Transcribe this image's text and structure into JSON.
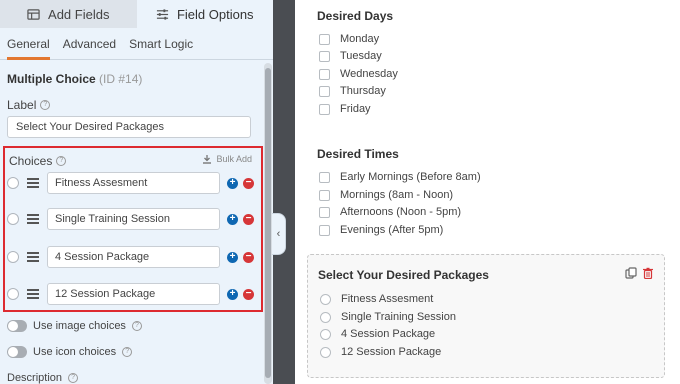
{
  "tabs": {
    "add_fields": "Add Fields",
    "field_options": "Field Options"
  },
  "subtabs": [
    "General",
    "Advanced",
    "Smart Logic"
  ],
  "field": {
    "type": "Multiple Choice",
    "id_label": "(ID #14)"
  },
  "label_section": {
    "label": "Label",
    "value": "Select Your Desired Packages"
  },
  "choices_section": {
    "label": "Choices",
    "bulk_add": "Bulk Add",
    "items": [
      "Fitness Assesment",
      "Single Training Session",
      "4 Session Package",
      "12 Session Package"
    ]
  },
  "toggles": {
    "image_choices": "Use image choices",
    "icon_choices": "Use icon choices"
  },
  "description_label": "Description",
  "preview": {
    "days": {
      "title": "Desired Days",
      "options": [
        "Monday",
        "Tuesday",
        "Wednesday",
        "Thursday",
        "Friday"
      ]
    },
    "times": {
      "title": "Desired Times",
      "options": [
        "Early Mornings (Before 8am)",
        "Mornings (8am - Noon)",
        "Afternoons (Noon - 5pm)",
        "Evenings (After 5pm)"
      ]
    },
    "packages": {
      "title": "Select Your Desired Packages",
      "options": [
        "Fitness Assesment",
        "Single Training Session",
        "4 Session Package",
        "12 Session Package"
      ]
    }
  },
  "colors": {
    "accent_orange": "#e27730",
    "highlight_red": "#dd2a30",
    "add_blue": "#0e67b2",
    "remove_red": "#d63638"
  }
}
